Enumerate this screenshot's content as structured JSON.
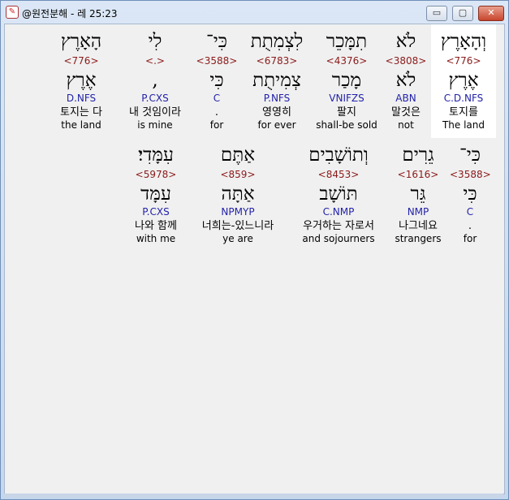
{
  "window": {
    "title": "@원전분해 - 레 25:23"
  },
  "controls": {
    "minimize": "▭",
    "maximize": "▢",
    "close": "✕"
  },
  "row1": [
    {
      "heb": "וְהָאָרֶץ",
      "num": "<776>",
      "lemma": "אֶרֶץ",
      "morph": "C.D.NFS",
      "kor": "토지를",
      "eng": "The land",
      "selected": true
    },
    {
      "heb": "לֹא",
      "num": "<3808>",
      "lemma": "לֹא",
      "morph": "ABN",
      "kor": "말것은",
      "eng": "not"
    },
    {
      "heb": "תִמָּכֵר",
      "num": "<4376>",
      "lemma": "מָכַר",
      "morph": "VNIFZS",
      "kor": "팔지",
      "eng": "shall-be sold"
    },
    {
      "heb": "לִצְמִתֻת",
      "num": "<6783>",
      "lemma": "צְמִיתֻת",
      "morph": "P.NFS",
      "kor": "영영히",
      "eng": "for ever"
    },
    {
      "heb": "כִּי־",
      "num": "<3588>",
      "lemma": "כִּי",
      "morph": "C",
      "kor": ".",
      "eng": "for"
    },
    {
      "heb": "לִי",
      "num": "<.>",
      "lemma": ",",
      "morph": "P.CXS",
      "kor": "내 것임이라",
      "eng": "is mine"
    },
    {
      "heb": "הָאָרֶץ",
      "num": "<776>",
      "lemma": "אֶרֶץ",
      "morph": "D.NFS",
      "kor": "토지는 다",
      "eng": "the land"
    }
  ],
  "row2": [
    {
      "heb": "כִּי־",
      "num": "<3588>",
      "lemma": "כִּי",
      "morph": "C",
      "kor": ".",
      "eng": "for"
    },
    {
      "heb": "גֵרִים",
      "num": "<1616>",
      "lemma": "גֵּר",
      "morph": "NMP",
      "kor": "나그네요",
      "eng": "strangers"
    },
    {
      "heb": "וְתוֹשָׁבִים",
      "num": "<8453>",
      "lemma": "תּוֹשָׁב",
      "morph": "C.NMP",
      "kor": "우거하는 자로서",
      "eng": "and sojourners"
    },
    {
      "heb": "אַתֶּם",
      "num": "<859>",
      "lemma": "אַתָּה",
      "morph": "NPMYP",
      "kor": "너희는-있느니라",
      "eng": "ye are"
    },
    {
      "heb": "עִמָּדִי׃",
      "num": "<5978>",
      "lemma": "עִמָּד",
      "morph": "P.CXS",
      "kor": "나와 함께",
      "eng": "with me"
    }
  ]
}
